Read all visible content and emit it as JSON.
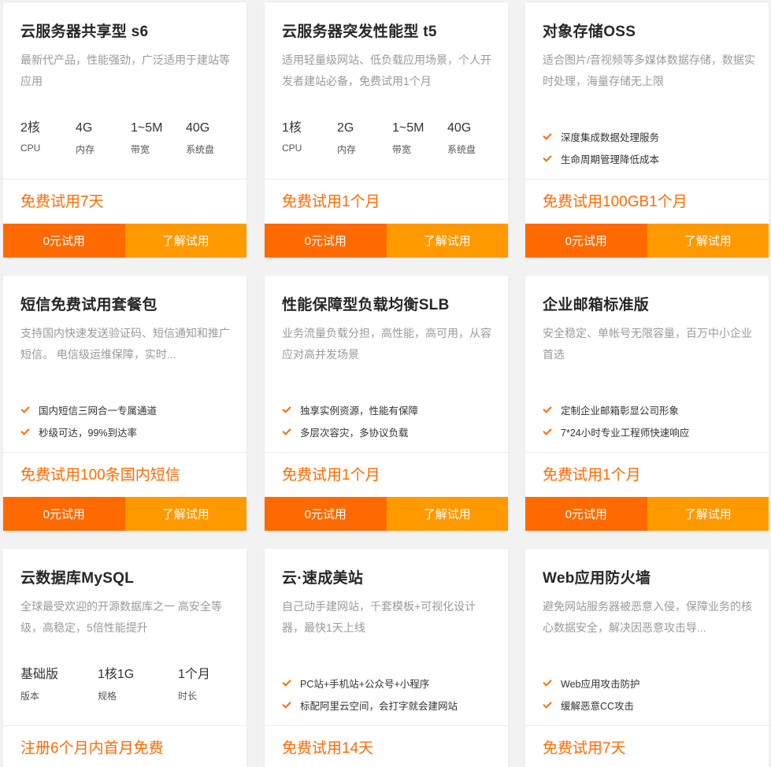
{
  "cards": [
    {
      "title": "云服务器共享型 s6",
      "desc": "最新代产品，性能强劲，广泛适用于建站等应用",
      "specs": [
        {
          "value": "2核",
          "label": "CPU"
        },
        {
          "value": "4G",
          "label": "内存"
        },
        {
          "value": "1~5M",
          "label": "带宽"
        },
        {
          "value": "40G",
          "label": "系统盘"
        }
      ],
      "promo": "免费试用7天",
      "btn_primary": "0元试用",
      "btn_secondary": "了解试用"
    },
    {
      "title": "云服务器突发性能型 t5",
      "desc": "适用轻量级网站、低负载应用场景，个人开发者建站必备，免费试用1个月",
      "specs": [
        {
          "value": "1核",
          "label": "CPU"
        },
        {
          "value": "2G",
          "label": "内存"
        },
        {
          "value": "1~5M",
          "label": "带宽"
        },
        {
          "value": "40G",
          "label": "系统盘"
        }
      ],
      "promo": "免费试用1个月",
      "btn_primary": "0元试用",
      "btn_secondary": "了解试用"
    },
    {
      "title": "对象存储OSS",
      "desc": "适合图片/音视频等多媒体数据存储，数据实时处理，海量存储无上限",
      "features": [
        "深度集成数据处理服务",
        "生命周期管理降低成本"
      ],
      "promo": "免费试用100GB1个月",
      "btn_primary": "0元试用",
      "btn_secondary": "了解试用"
    },
    {
      "title": "短信免费试用套餐包",
      "desc": "支持国内快速发送验证码、短信通知和推广短信。 电信级运维保障，实时...",
      "features": [
        "国内短信三网合一专属通道",
        "秒级可达，99%到达率"
      ],
      "promo": "免费试用100条国内短信",
      "btn_primary": "0元试用",
      "btn_secondary": "了解试用"
    },
    {
      "title": "性能保障型负载均衡SLB",
      "desc": "业务流量负载分担，高性能，高可用，从容应对高并发场景",
      "features": [
        "独享实例资源，性能有保障",
        "多层次容灾，多协议负载"
      ],
      "promo": "免费试用1个月",
      "btn_primary": "0元试用",
      "btn_secondary": "了解试用"
    },
    {
      "title": "企业邮箱标准版",
      "desc": "安全稳定、单帐号无限容量，百万中小企业首选",
      "features": [
        "定制企业邮箱彰显公司形象",
        "7*24小时专业工程师快速响应"
      ],
      "promo": "免费试用1个月",
      "btn_primary": "0元试用",
      "btn_secondary": "了解试用"
    },
    {
      "title": "云数据库MySQL",
      "desc": "全球最受欢迎的开源数据库之一 高安全等级，高稳定，5倍性能提升",
      "specs": [
        {
          "value": "基础版",
          "label": "版本"
        },
        {
          "value": "1核1G",
          "label": "规格"
        },
        {
          "value": "1个月",
          "label": "时长"
        }
      ],
      "promo": "注册6个月内首月免费"
    },
    {
      "title": "云·速成美站",
      "desc": "自己动手建网站，千套模板+可视化设计器，最快1天上线",
      "features": [
        "PC站+手机站+公众号+小程序",
        "标配阿里云空间，会打字就会建网站"
      ],
      "promo": "免费试用14天"
    },
    {
      "title": "Web应用防火墙",
      "desc": "避免网站服务器被恶意入侵，保障业务的核心数据安全，解决因恶意攻击导...",
      "features": [
        "Web应用攻击防护",
        "缓解恶意CC攻击"
      ],
      "promo": "免费试用7天"
    }
  ]
}
